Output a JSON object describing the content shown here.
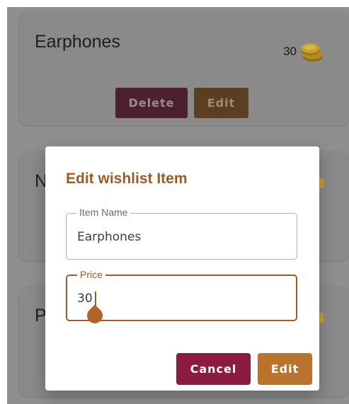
{
  "wishlist": {
    "items": [
      {
        "name": "Earphones",
        "price": "30",
        "price_icon": "gold-coins-icon"
      },
      {
        "name": "N"
      },
      {
        "name": "P"
      }
    ],
    "delete_label": "Delete",
    "edit_label": "Edit"
  },
  "dialog": {
    "title": "Edit wishlist Item",
    "name_label": "Item Name",
    "name_value": "Earphones",
    "price_label": "Price",
    "price_value": "30",
    "cancel_label": "Cancel",
    "edit_label": "Edit"
  },
  "colors": {
    "accent": "#9e5c24",
    "cancel": "#8c1b40",
    "edit": "#b9732d",
    "scrim": "#8f8f8f"
  }
}
